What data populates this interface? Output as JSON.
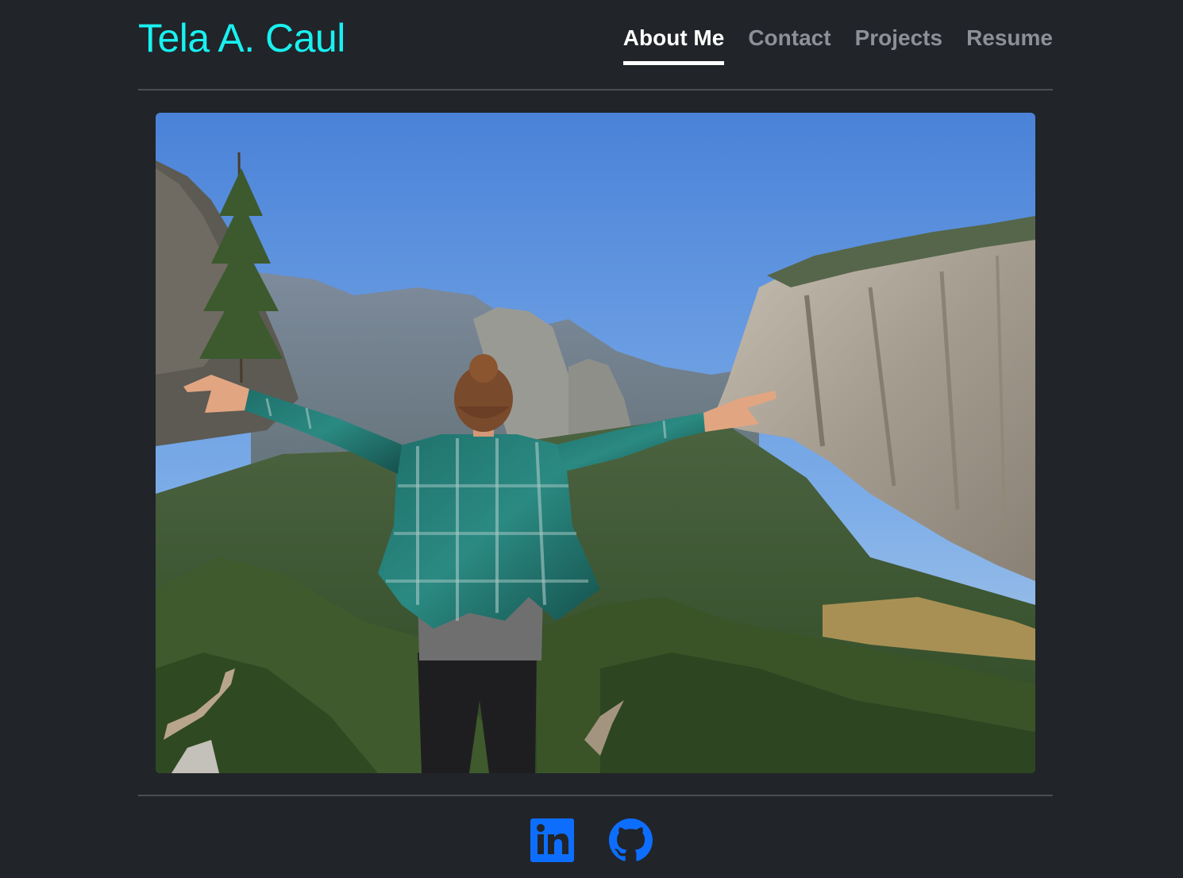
{
  "header": {
    "title": "Tela A. Caul",
    "nav": [
      {
        "label": "About Me",
        "active": true
      },
      {
        "label": "Contact",
        "active": false
      },
      {
        "label": "Projects",
        "active": false
      },
      {
        "label": "Resume",
        "active": false
      }
    ]
  },
  "hero": {
    "image_subject": "hiker-with-outstretched-arms-overlooking-mountain-valley"
  },
  "footer": {
    "social": [
      {
        "icon": "linkedin-icon"
      },
      {
        "icon": "github-icon"
      }
    ]
  },
  "colors": {
    "background": "#212429",
    "title_accent": "#19f0f0",
    "nav_active": "#ffffff",
    "nav_inactive": "#8d9096",
    "social_icon": "#0d6efd",
    "divider": "#4a4d52"
  }
}
